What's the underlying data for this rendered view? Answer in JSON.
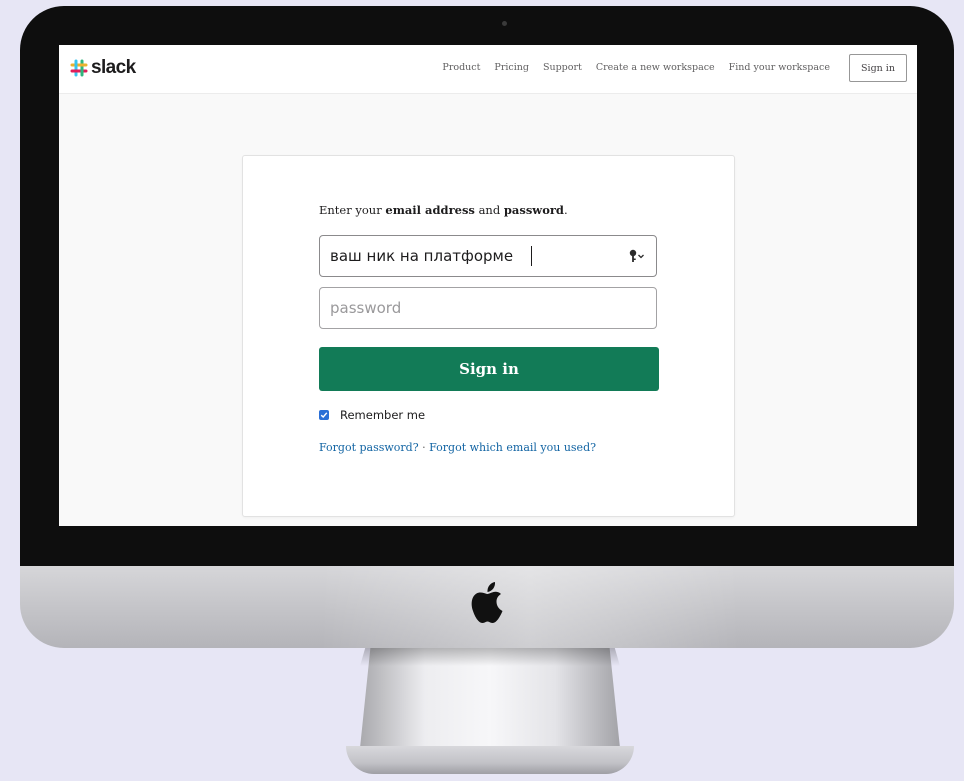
{
  "colors": {
    "accent_green": "#127b57",
    "link_blue": "#1264a3",
    "checkbox_blue": "#2a6fd6",
    "bezel": "#0e0e0e",
    "background": "#e7e6f5"
  },
  "device": {
    "logo_icon": "apple-icon"
  },
  "header": {
    "logo_text": "slack",
    "logo_icon": "slack-hashtag-icon",
    "nav": [
      "Product",
      "Pricing",
      "Support",
      "Create a new workspace",
      "Find your workspace"
    ],
    "signin_label": "Sign in"
  },
  "form": {
    "prompt_before": "Enter your ",
    "prompt_bold1": "email address",
    "prompt_middle": " and ",
    "prompt_bold2": "password",
    "prompt_after": ".",
    "email_value": "ваш ник на платформе",
    "email_icon": "key-dropdown-icon",
    "password_placeholder": "password",
    "signin_button": "Sign in",
    "remember_label": "Remember me",
    "remember_checked": true,
    "forgot_password": "Forgot password?",
    "separator": " · ",
    "forgot_email": "Forgot which email you used?"
  }
}
